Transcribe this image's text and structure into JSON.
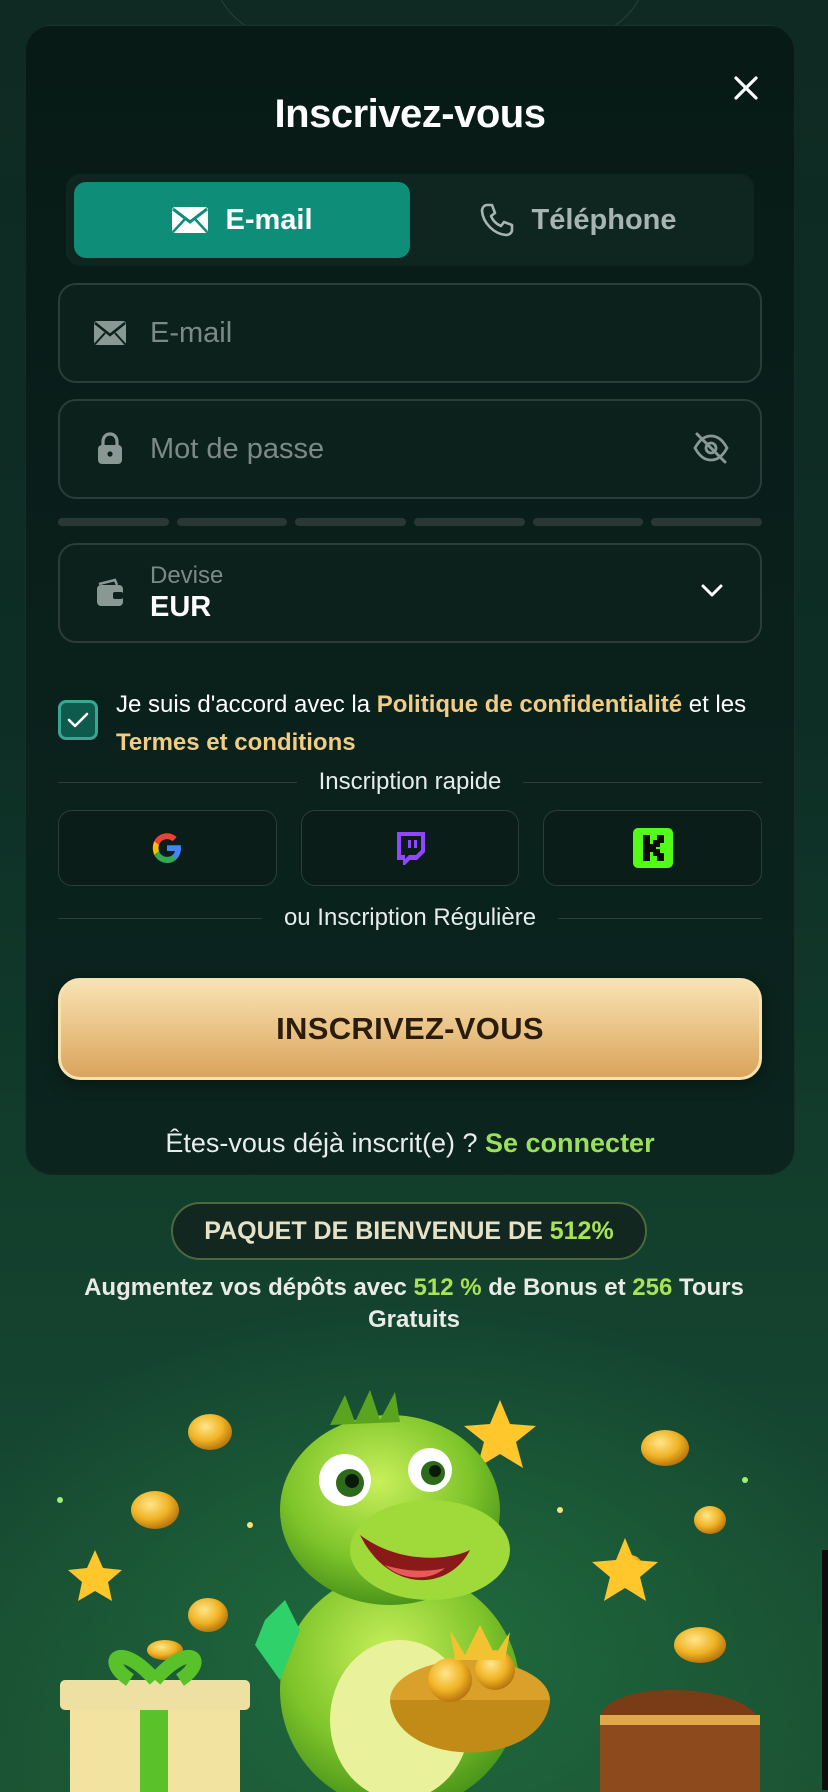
{
  "modal": {
    "title": "Inscrivez-vous",
    "close_icon": "close-icon"
  },
  "tabs": [
    {
      "label": "E-mail",
      "icon": "mail-icon",
      "active": true
    },
    {
      "label": "Téléphone",
      "icon": "phone-icon",
      "active": false
    }
  ],
  "form": {
    "email_placeholder": "E-mail",
    "password_placeholder": "Mot de passe",
    "currency_label": "Devise",
    "currency_value": "EUR"
  },
  "agreement": {
    "checked": true,
    "text_part1": "Je suis d'accord avec la ",
    "privacy_link": "Politique de confidentialité",
    "text_part2": " et les ",
    "terms_link": "Termes et conditions"
  },
  "quick_signup": {
    "label": "Inscription rapide",
    "providers": [
      "google-icon",
      "twitch-icon",
      "kick-icon"
    ]
  },
  "regular_signup_label": "ou Inscription Régulière",
  "submit_label": "INSCRIVEZ-VOUS",
  "login": {
    "prompt": "Êtes-vous déjà inscrit(e) ? ",
    "link": "Se connecter"
  },
  "bonus": {
    "pill_text": "PAQUET DE BIENVENUE DE ",
    "pill_percent": "512%",
    "desc_1": "Augmentez vos dépôts avec ",
    "desc_percent": "512 %",
    "desc_2": " de Bonus et ",
    "desc_spins": "256",
    "desc_3": " Tours Gratuits"
  },
  "colors": {
    "accent_teal": "#0e8e78",
    "gold_link": "#f0cc85",
    "green_link": "#9be05a",
    "cta_gold": "#eac386"
  }
}
